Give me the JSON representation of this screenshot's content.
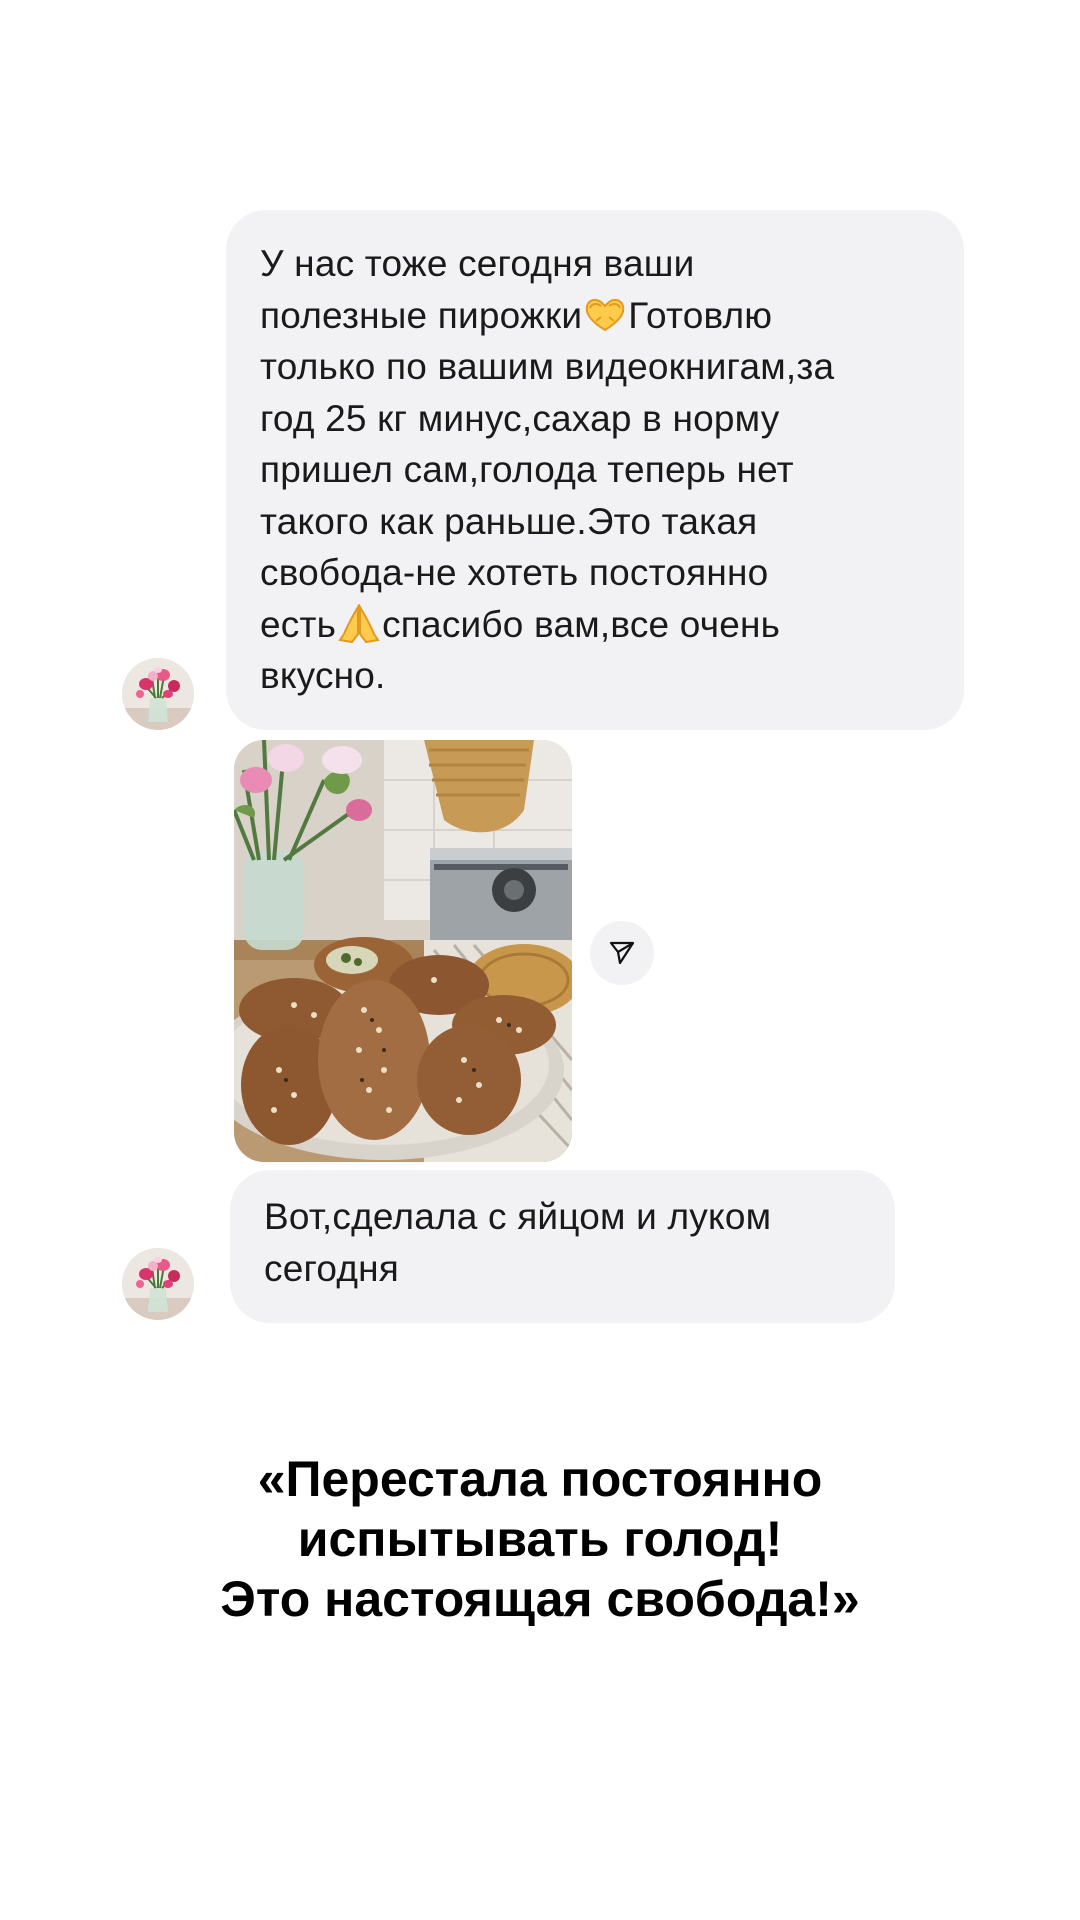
{
  "messages": [
    {
      "type": "text",
      "lines": [
        "У нас тоже сегодня ваши",
        "полезные пирожки",
        "Готовлю",
        "только по вашим видеокнигам,за",
        "год 25 кг минус,сахар в норму",
        "пришел сам,голода теперь нет",
        "такого как раньше.Это такая",
        "свобода-не хотеть постоянно",
        "есть",
        "спасибо вам,все очень",
        "вкусно."
      ],
      "emojis": [
        "heart-hands-emoji",
        "folded-hands-emoji"
      ]
    },
    {
      "type": "image",
      "icon": "pirozhki-photo"
    },
    {
      "type": "text",
      "lines": [
        "Вот,сделала с яйцом и луком",
        "сегодня"
      ]
    }
  ],
  "share_icon": "paper-plane-icon",
  "quote": {
    "lines": [
      "«Перестала постоянно",
      "испытывать голод!",
      "Это настоящая свобода!»"
    ]
  },
  "colors": {
    "bubble": "#f2f2f4",
    "text": "#1a1a1a",
    "quote": "#000000",
    "background": "#ffffff"
  }
}
